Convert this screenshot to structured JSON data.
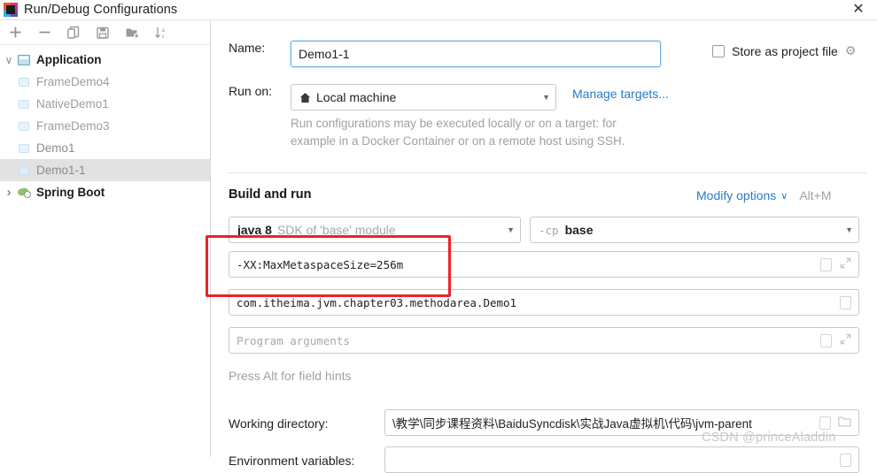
{
  "window": {
    "title": "Run/Debug Configurations",
    "close_label": "✕",
    "app_icon": "intellij-idea-icon"
  },
  "tree_toolbar": {
    "buttons": [
      {
        "name": "add-configuration-button",
        "icon": "plus-icon",
        "label": "+"
      },
      {
        "name": "remove-configuration-button",
        "icon": "minus-icon",
        "label": "−"
      },
      {
        "name": "copy-configuration-button",
        "icon": "copy-icon",
        "label": ""
      },
      {
        "name": "save-configuration-button",
        "icon": "save-icon",
        "label": ""
      },
      {
        "name": "new-folder-button",
        "icon": "folder-add-icon",
        "label": ""
      },
      {
        "name": "sort-configurations-button",
        "icon": "sort-alpha-icon",
        "label": ""
      }
    ]
  },
  "tree": {
    "nodes": [
      {
        "label": "Application",
        "level": 0,
        "expanded": true,
        "bold": true,
        "icon": "application-folder-icon",
        "selected": false
      },
      {
        "label": "FrameDemo4",
        "level": 1,
        "expanded": null,
        "bold": false,
        "icon": "run-config-icon",
        "selected": false
      },
      {
        "label": "NativeDemo1",
        "level": 1,
        "expanded": null,
        "bold": false,
        "icon": "run-config-icon",
        "selected": false
      },
      {
        "label": "FrameDemo3",
        "level": 1,
        "expanded": null,
        "bold": false,
        "icon": "run-config-icon",
        "selected": false
      },
      {
        "label": "Demo1",
        "level": 1,
        "expanded": null,
        "bold": false,
        "icon": "run-config-icon",
        "selected": false
      },
      {
        "label": "Demo1-1",
        "level": 1,
        "expanded": null,
        "bold": false,
        "icon": "run-config-icon",
        "selected": true
      },
      {
        "label": "Spring Boot",
        "level": 0,
        "expanded": false,
        "bold": true,
        "icon": "spring-boot-icon",
        "selected": false
      }
    ]
  },
  "form": {
    "name_label": "Name:",
    "name_value": "Demo1-1",
    "store_as_project_file_label": "Store as project file",
    "store_as_project_file_checked": false,
    "run_on_label": "Run on:",
    "run_on_value": "Local machine",
    "manage_targets_link": "Manage targets...",
    "run_on_hint_line1": "Run configurations may be executed locally or on a target: for",
    "run_on_hint_line2": "example in a Docker Container or on a remote host using SSH.",
    "build_and_run_title": "Build and run",
    "modify_options_link": "Modify options",
    "modify_options_shortcut": "Alt+M",
    "jre_value_bold": "java 8",
    "jre_value_grey": "SDK of 'base' module",
    "classpath_prefix": "-cp",
    "classpath_module": "base",
    "vm_options_value": "-XX:MaxMetaspaceSize=256m",
    "main_class_value": "com.itheima.jvm.chapter03.methodarea.Demo1",
    "program_arguments_placeholder": "Program arguments",
    "field_hints_text": "Press Alt for field hints",
    "working_directory_label": "Working directory:",
    "working_directory_value": "\\教学\\同步课程资料\\BaiduSyncdisk\\实战Java虚拟机\\代码\\jvm-parent",
    "environment_variables_label": "Environment variables:",
    "environment_variables_value": ""
  },
  "annotation": {
    "color": "#e8242a",
    "target": "vm-options-field"
  },
  "watermark": {
    "text": "CSDN @princeAladdin"
  }
}
